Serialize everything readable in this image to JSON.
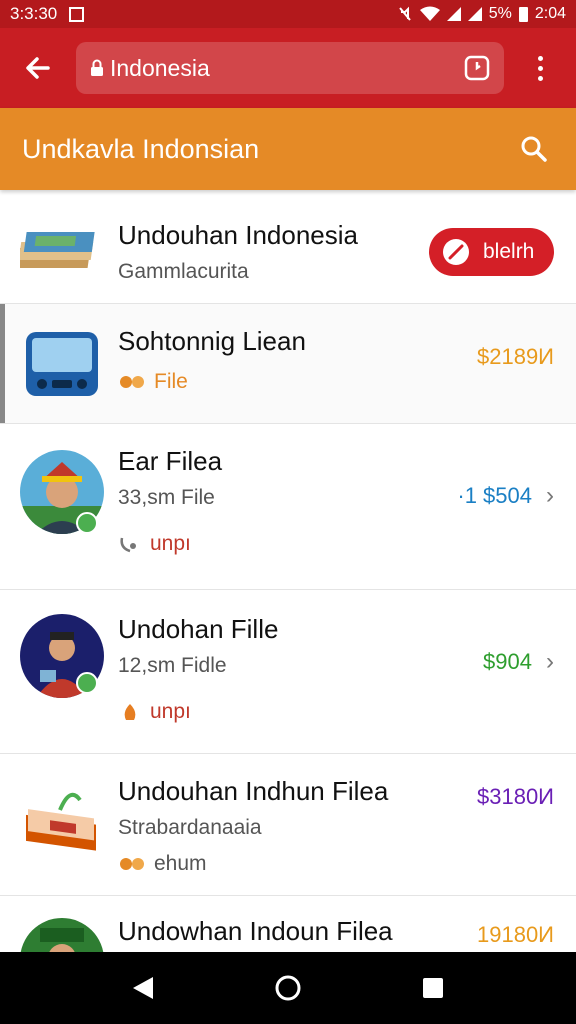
{
  "status_bar": {
    "time_left": "3:3:30",
    "battery_percent": "5%",
    "time_right": "2:04"
  },
  "browser": {
    "url": "Indonesia"
  },
  "header": {
    "title": "Undkavla Indonsian"
  },
  "items": [
    {
      "title": "Undouhan Indonesia",
      "subtitle": "Gammlacurita",
      "button_label": "blelrh"
    },
    {
      "title": "Sohtonnig Liean",
      "meta": "File",
      "price": "$2189И"
    },
    {
      "title": "Ear Filea",
      "subtitle": "33,sm File",
      "meta": "unpı",
      "price": "·1 $504"
    },
    {
      "title": "Undohan Fille",
      "subtitle": "12,sm Fidle",
      "meta": "unpı",
      "price": "$904"
    },
    {
      "title": "Undouhan Indhun Filea",
      "subtitle": "Strabardanaaia",
      "meta": "ehum",
      "price": "$3180И"
    },
    {
      "title": "Undowhan Indoun Filea",
      "price": "19180И"
    }
  ],
  "colors": {
    "status_bar": "#b3191c",
    "address_bar": "#c81e23",
    "header": "#e58a26",
    "price_orange": "#e89a1c",
    "price_blue": "#1a7fc4",
    "price_green": "#2e9e2e",
    "price_purple": "#6a1fb5",
    "meta_red": "#c0392b"
  }
}
